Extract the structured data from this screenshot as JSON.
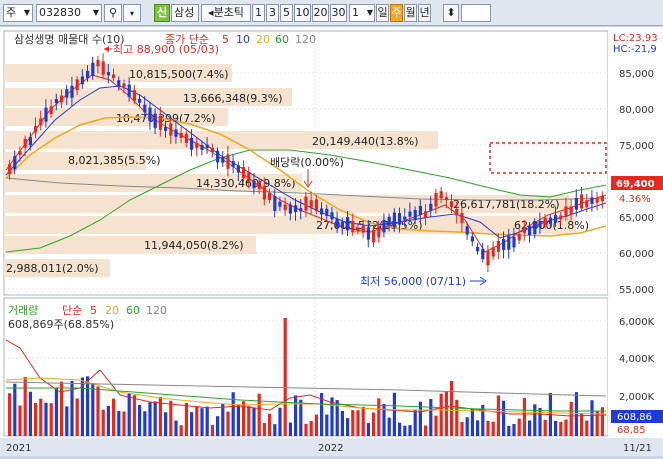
{
  "toolbar": {
    "market": "주",
    "code": "032830",
    "name_badge": "신",
    "stock_name": "삼성",
    "period_prefix": "◂분초틱",
    "intervals": [
      "1",
      "3",
      "5",
      "10",
      "20",
      "30"
    ],
    "interval_value": "1",
    "periods": [
      "일",
      "주",
      "월",
      "년"
    ],
    "active_period": "주"
  },
  "price_panel": {
    "title": "삼성생명 매물대 수(10)",
    "ma_label": "종가 단순",
    "ma_periods": [
      "5",
      "10",
      "20",
      "60",
      "120"
    ],
    "high_label": "최고 88,900 (05/03)",
    "low_label": "최저 56,000 (07/11)",
    "dividend_label": "배당락(0.00%)",
    "lc_label": "LC:23,93",
    "hc_label": "HC:-21,9",
    "current_price": "69,400",
    "current_change": "4.36%",
    "axis_ticks": [
      "85,000",
      "80,000",
      "75,000",
      "70,000",
      "65,000",
      "60,000",
      "55,000"
    ],
    "volume_profile": [
      "10,815,500(7.4%)",
      "13,666,348(9.3%)",
      "10,470,399(7.2%)",
      "20,149,440(13.8%)",
      "8,021,385(5.5%)",
      "14,330,460(9.8%)",
      "26,617,781(18.2%)",
      "27,000,572(18.5%)",
      "62,800(1.8%)",
      "11,944,050(8.2%)",
      "2,988,011(2.0%)"
    ]
  },
  "volume_panel": {
    "title": "거래량",
    "ma_label": "단순",
    "ma_periods": [
      "5",
      "20",
      "60",
      "120"
    ],
    "current_label": "608,869주(68.85%)",
    "axis_ticks": [
      "6,000K",
      "4,000K",
      "2,000K"
    ],
    "current_badge": "608,86",
    "sub_badge": "68,85"
  },
  "time_axis": [
    "2021",
    "2022",
    "11/21"
  ],
  "colors": {
    "up": "#e8271e",
    "down": "#1f3bd6",
    "ma5": "#e8271e",
    "ma10": "#1f3bd6",
    "ma20": "#f0a818",
    "ma60": "#2aa52a",
    "ma120": "#888888",
    "profile": "#f5e3cf"
  }
}
